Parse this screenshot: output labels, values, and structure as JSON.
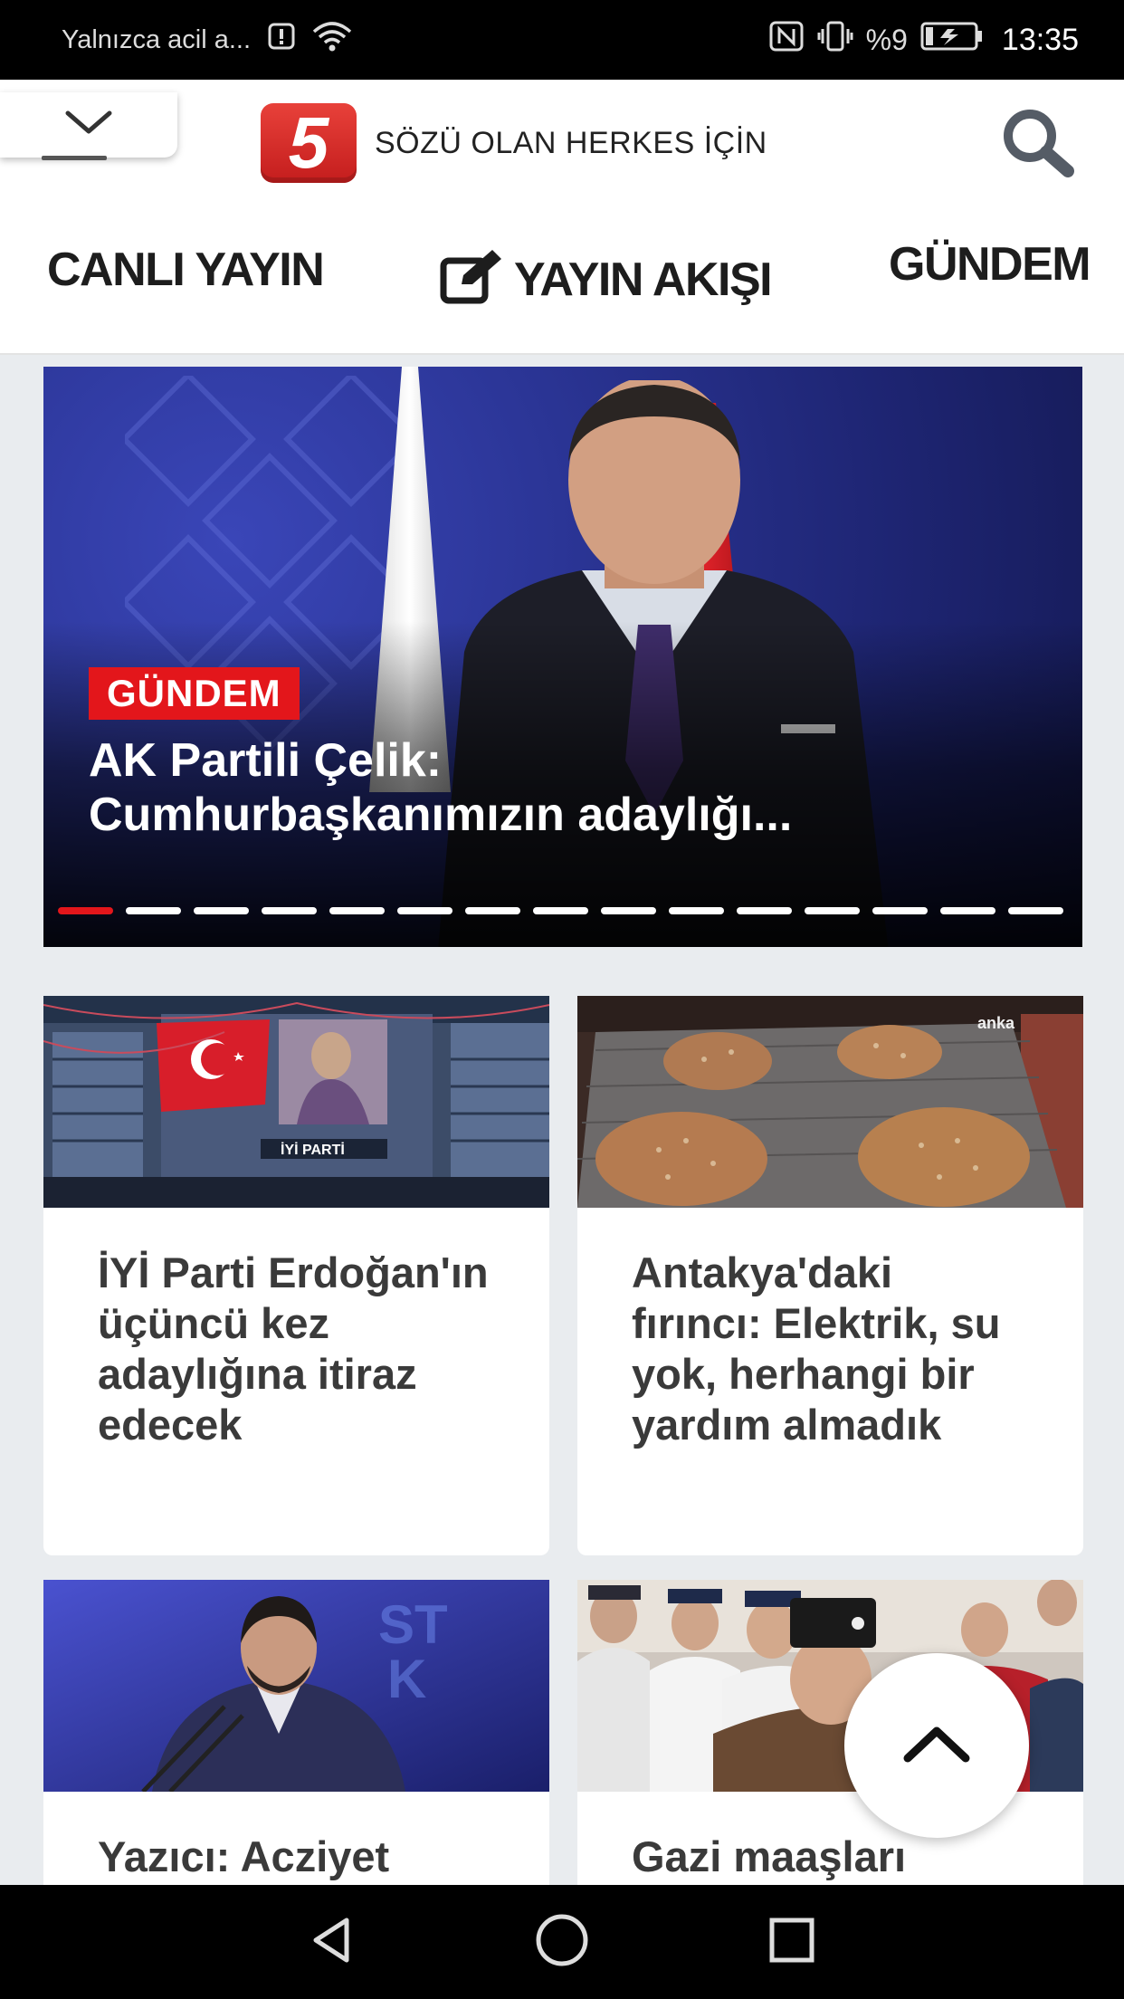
{
  "status_bar": {
    "carrier": "Yalnızca acil a...",
    "battery": "%9",
    "time": "13:35"
  },
  "header": {
    "logo_number": "5",
    "slogan": "SÖZÜ OLAN HERKES İÇİN",
    "brand_color": "#e3161b"
  },
  "nav": {
    "items": [
      {
        "label": "CANLI YAYIN"
      },
      {
        "label": "YAYIN AKIŞI",
        "icon": "edit-icon"
      },
      {
        "label": "GÜNDEM"
      }
    ]
  },
  "slider": {
    "category": "GÜNDEM",
    "title_line1": "AK Partili Çelik:",
    "title_line2": "Cumhurbaşkanımızın adaylığı...",
    "total_slides": 15,
    "active_index": 0
  },
  "cards": [
    {
      "title": "İYİ Parti Erdoğan'ın üçüncü kez adaylığına itiraz edecek",
      "image_caption": "İYİ PARTİ"
    },
    {
      "title": "Antakya'daki fırıncı: Elektrik, su yok, herhangi bir yardım almadık",
      "image_caption": "anka"
    },
    {
      "title": "Yazıcı: Acziyet"
    },
    {
      "title": "Gazi maaşları"
    }
  ]
}
